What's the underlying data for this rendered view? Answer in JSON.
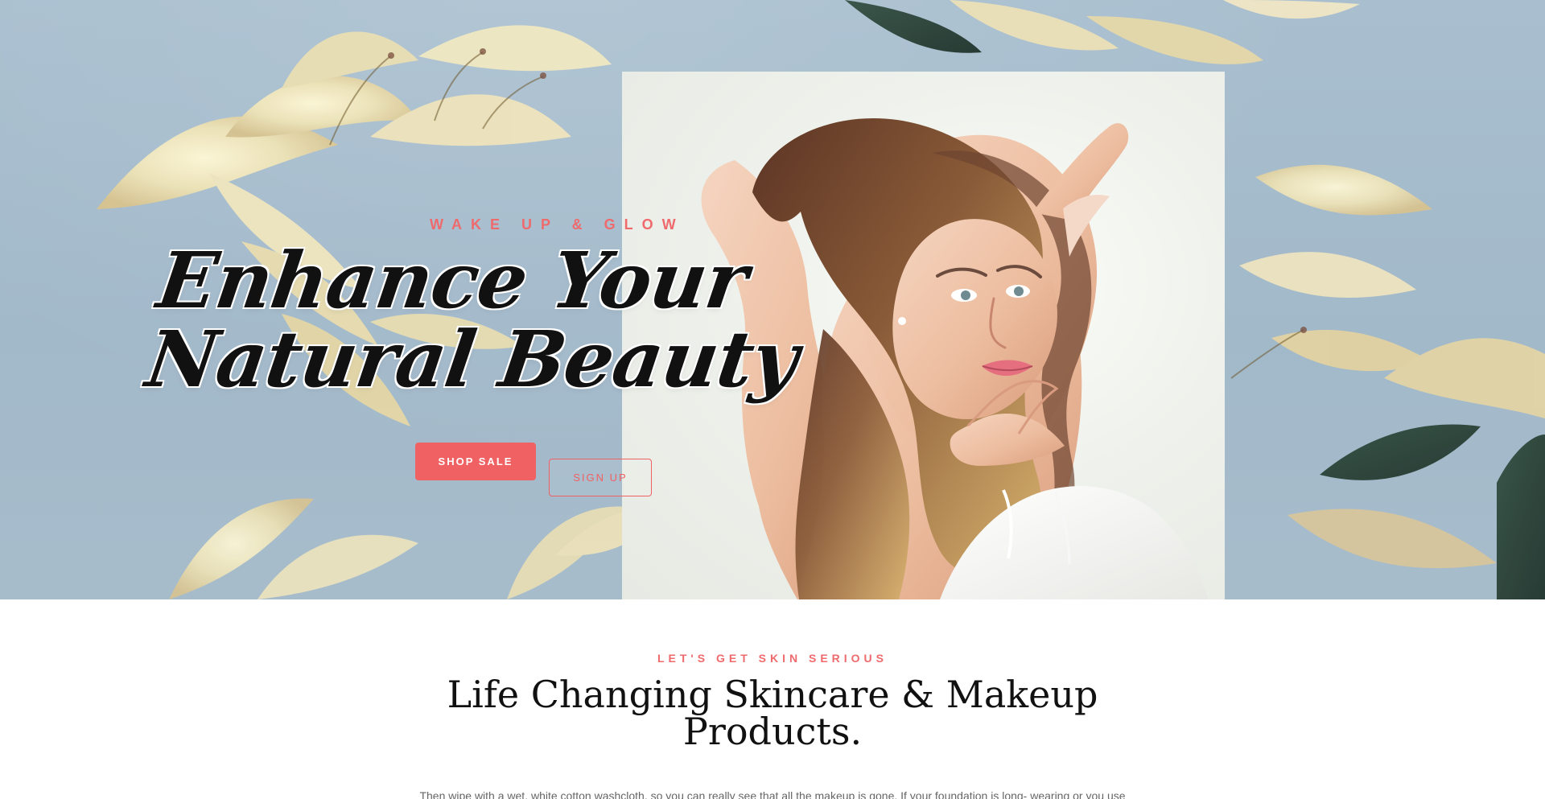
{
  "hero": {
    "eyebrow": "WAKE UP & GLOW",
    "title_line_1": "Enhance Your",
    "title_line_2": "Natural Beauty",
    "buttons": {
      "primary_label": "SHOP SALE",
      "secondary_label": "SIGN UP"
    }
  },
  "intro": {
    "eyebrow": "LET'S GET SKIN SERIOUS",
    "title": "Life Changing Skincare & Makeup Products.",
    "text": "Then wipe with a wet, white cotton washcloth, so you can really see that all the makeup is gone. If your foundation is long- wearing or you use"
  },
  "colors": {
    "accent": "#ef6163",
    "hero_background": "#a6bccb",
    "portrait_background": "#edf1ea",
    "heading": "#111111",
    "body_text": "#666666"
  },
  "icons": {
    "background": "floral-background",
    "portrait": "woman-portrait-image"
  }
}
